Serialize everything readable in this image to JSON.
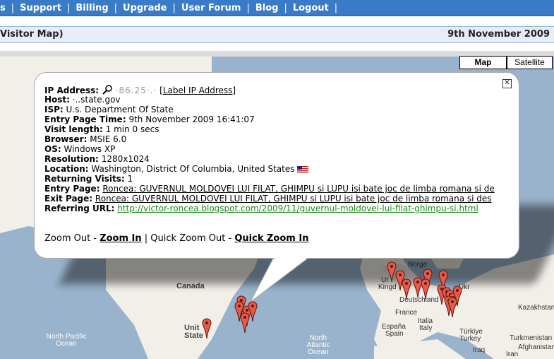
{
  "nav": {
    "items": [
      "s",
      "Support",
      "Billing",
      "Upgrade",
      "User Forum",
      "Blog",
      "Logout"
    ],
    "separator": "|"
  },
  "header": {
    "title": "Visitor Map)",
    "date": "9th November 2009"
  },
  "map_controls": {
    "map_label": "Map",
    "satellite_label": "Satellite"
  },
  "map_labels": {
    "canada": "Canada",
    "united_states_1": "Unit",
    "united_states_2": "State",
    "north_pacific_1": "North Pacific",
    "north_pacific_2": "Ocean",
    "north_atlantic_1": "North",
    "north_atlantic_2": "Atlantic",
    "north_atlantic_3": "Ocean",
    "norge": "Norge",
    "uk_1": "Ur",
    "uk_2": "Kingd",
    "deutschland": "Deutschland",
    "france": "France",
    "espana": "España",
    "spain": "Spain",
    "italia": "Italia",
    "italy": "Italy",
    "turkiye": "Türkiye",
    "turkey": "Turkey",
    "kazakhstan": "Kazakhstan",
    "turkmenistan": "Turkmenistan",
    "afghanistan": "Afghanistan",
    "iraq": "Iraq",
    "iran": "Iran",
    "ukraine": "Ukr"
  },
  "info": {
    "ip_label": "IP Address:",
    "ip_value": "·86.25·.·",
    "label_ip_link": "[Label IP Address]",
    "host_label": "Host:",
    "host_value": "·..state.gov",
    "isp_label": "ISP:",
    "isp_value": "U.s. Department Of State",
    "entry_time_label": "Entry Page Time:",
    "entry_time_value": "9th November 2009 16:41:07",
    "visit_length_label": "Visit length:",
    "visit_length_value": "1 min 0 secs",
    "browser_label": "Browser:",
    "browser_value": "MSIE 6.0",
    "os_label": "OS:",
    "os_value": "Windows XP",
    "resolution_label": "Resolution:",
    "resolution_value": "1280x1024",
    "location_label": "Location:",
    "location_value": "Washington, District Of Columbia, United States",
    "returning_label": "Returning Visits:",
    "returning_value": "1",
    "entry_page_label": "Entry Page:",
    "entry_page_value": "Roncea: GUVERNUL MOLDOVEI LUI FILAT, GHIMPU si LUPU isi bate joc de limba romana si de",
    "exit_page_label": "Exit Page:",
    "exit_page_value": "Roncea: GUVERNUL MOLDOVEI LUI FILAT, GHIMPU si LUPU isi bate joc de limba romana si des",
    "referring_label": "Referring URL:",
    "referring_value": "http://victor-roncea.blogspot.com/2009/11/guvernul-moldovei-lui-filat-ghimpu-si.html"
  },
  "zoom": {
    "zoom_out": "Zoom Out",
    "sep1": "-",
    "zoom_in": "Zoom In",
    "sep2": "|",
    "quick_zoom_out": "Quick Zoom Out",
    "sep3": "-",
    "quick_zoom_in": "Quick Zoom In"
  },
  "icons": {
    "magnifier": "magnifier-icon",
    "close": "close-icon",
    "flag": "us-flag-icon",
    "marker": "map-marker-icon"
  },
  "colors": {
    "nav_bg": "#3a7bc8",
    "water": "#99b3cc",
    "land": "#f2efe9",
    "marker": "#e8594a",
    "link_green": "#1a8a1a"
  }
}
